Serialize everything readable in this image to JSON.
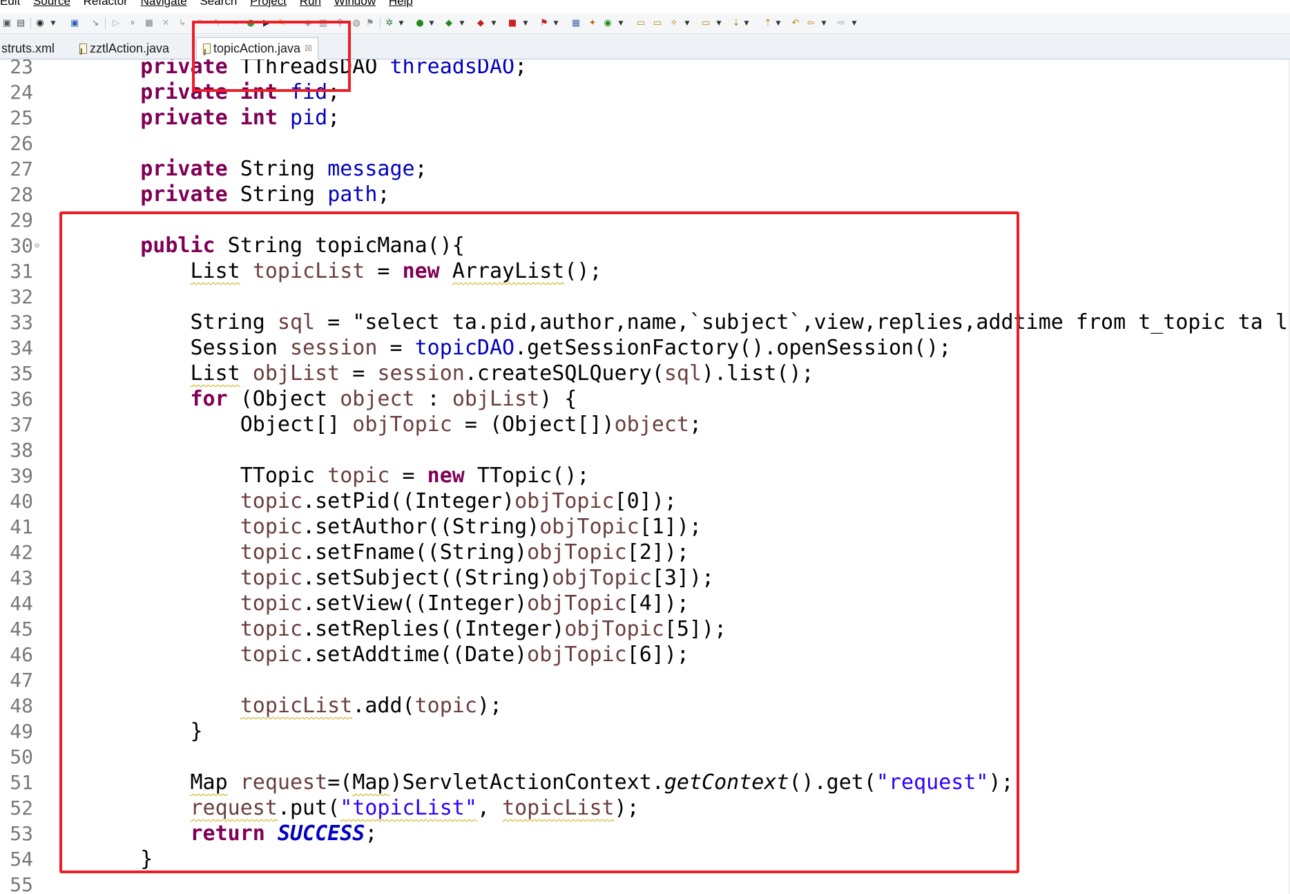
{
  "menu": [
    "Edit",
    "Source",
    "Refactor",
    "Navigate",
    "Search",
    "Project",
    "Run",
    "Window",
    "Help"
  ],
  "tabs": [
    {
      "label": "struts.xml",
      "active": false
    },
    {
      "label": "zztlAction.java",
      "active": false
    },
    {
      "label": "topicAction.java",
      "active": true
    }
  ],
  "close_glyph": "☒",
  "colors": {
    "keyword": "#7f0055",
    "field": "#0000c0",
    "local_variable": "#6a3e3e",
    "string": "#2a00ff",
    "line_number": "#787878",
    "annotation_box": "#ee1c25"
  },
  "editor": {
    "lines": [
      {
        "num": "23",
        "segs": [
          [
            "    ",
            ""
          ],
          [
            "private",
            "kw"
          ],
          [
            " TThreadsDAO ",
            ""
          ],
          [
            "threadsDAO",
            "fld"
          ],
          [
            ";",
            ""
          ]
        ]
      },
      {
        "num": "24",
        "segs": [
          [
            "    ",
            ""
          ],
          [
            "private",
            "kw"
          ],
          [
            " ",
            ""
          ],
          [
            "int",
            "kw"
          ],
          [
            " ",
            ""
          ],
          [
            "fid",
            "fld"
          ],
          [
            ";",
            ""
          ]
        ]
      },
      {
        "num": "25",
        "segs": [
          [
            "    ",
            ""
          ],
          [
            "private",
            "kw"
          ],
          [
            " ",
            ""
          ],
          [
            "int",
            "kw"
          ],
          [
            " ",
            ""
          ],
          [
            "pid",
            "fld"
          ],
          [
            ";",
            ""
          ]
        ]
      },
      {
        "num": "26",
        "segs": []
      },
      {
        "num": "27",
        "segs": [
          [
            "    ",
            ""
          ],
          [
            "private",
            "kw"
          ],
          [
            " String ",
            ""
          ],
          [
            "message",
            "fld"
          ],
          [
            ";",
            ""
          ]
        ]
      },
      {
        "num": "28",
        "segs": [
          [
            "    ",
            ""
          ],
          [
            "private",
            "kw"
          ],
          [
            " String ",
            ""
          ],
          [
            "path",
            "fld"
          ],
          [
            ";",
            ""
          ]
        ]
      },
      {
        "num": "29",
        "segs": []
      },
      {
        "num": "30",
        "mark": "⊖",
        "segs": [
          [
            "    ",
            ""
          ],
          [
            "public",
            "kw"
          ],
          [
            " String topicMana(){",
            ""
          ]
        ]
      },
      {
        "num": "31",
        "segs": [
          [
            "        ",
            ""
          ],
          [
            "List",
            "sq"
          ],
          [
            " ",
            ""
          ],
          [
            "topicList",
            "loc"
          ],
          [
            " = ",
            ""
          ],
          [
            "new",
            "kw"
          ],
          [
            " ",
            ""
          ],
          [
            "ArrayList",
            "sq"
          ],
          [
            "();",
            ""
          ]
        ]
      },
      {
        "num": "32",
        "segs": []
      },
      {
        "num": "33",
        "segs": [
          [
            "        String ",
            ""
          ],
          [
            "sql",
            "loc"
          ],
          [
            " = ",
            ""
          ],
          [
            "\"select ta.pid,author,name,`subject`,view,replies,addtime from t_topic ta left join",
            ""
          ]
        ]
      },
      {
        "num": "34",
        "segs": [
          [
            "        Session ",
            ""
          ],
          [
            "session",
            "loc"
          ],
          [
            " = ",
            ""
          ],
          [
            "topicDAO",
            "fld"
          ],
          [
            ".getSessionFactory().openSession();",
            ""
          ]
        ]
      },
      {
        "num": "35",
        "segs": [
          [
            "        ",
            ""
          ],
          [
            "List",
            "sq"
          ],
          [
            " ",
            ""
          ],
          [
            "objList",
            "loc"
          ],
          [
            " = ",
            ""
          ],
          [
            "session",
            "loc"
          ],
          [
            ".createSQLQuery(",
            ""
          ],
          [
            "sql",
            "loc"
          ],
          [
            ").list();",
            ""
          ]
        ]
      },
      {
        "num": "36",
        "segs": [
          [
            "        ",
            ""
          ],
          [
            "for",
            "kw"
          ],
          [
            " (Object ",
            ""
          ],
          [
            "object",
            "loc"
          ],
          [
            " : ",
            ""
          ],
          [
            "objList",
            "loc"
          ],
          [
            ") {",
            ""
          ]
        ]
      },
      {
        "num": "37",
        "segs": [
          [
            "            Object[] ",
            ""
          ],
          [
            "objTopic",
            "loc"
          ],
          [
            " = (Object[])",
            ""
          ],
          [
            "object",
            "loc"
          ],
          [
            ";",
            ""
          ]
        ]
      },
      {
        "num": "38",
        "segs": []
      },
      {
        "num": "39",
        "segs": [
          [
            "            TTopic ",
            ""
          ],
          [
            "topic",
            "loc"
          ],
          [
            " = ",
            ""
          ],
          [
            "new",
            "kw"
          ],
          [
            " TTopic();",
            ""
          ]
        ]
      },
      {
        "num": "40",
        "segs": [
          [
            "            ",
            ""
          ],
          [
            "topic",
            "loc"
          ],
          [
            ".setPid((Integer)",
            ""
          ],
          [
            "objTopic",
            "loc"
          ],
          [
            "[0]);",
            ""
          ]
        ]
      },
      {
        "num": "41",
        "segs": [
          [
            "            ",
            ""
          ],
          [
            "topic",
            "loc"
          ],
          [
            ".setAuthor((String)",
            ""
          ],
          [
            "objTopic",
            "loc"
          ],
          [
            "[1]);",
            ""
          ]
        ]
      },
      {
        "num": "42",
        "segs": [
          [
            "            ",
            ""
          ],
          [
            "topic",
            "loc"
          ],
          [
            ".setFname((String)",
            ""
          ],
          [
            "objTopic",
            "loc"
          ],
          [
            "[2]);",
            ""
          ]
        ]
      },
      {
        "num": "43",
        "segs": [
          [
            "            ",
            ""
          ],
          [
            "topic",
            "loc"
          ],
          [
            ".setSubject((String)",
            ""
          ],
          [
            "objTopic",
            "loc"
          ],
          [
            "[3]);",
            ""
          ]
        ]
      },
      {
        "num": "44",
        "segs": [
          [
            "            ",
            ""
          ],
          [
            "topic",
            "loc"
          ],
          [
            ".setView((Integer)",
            ""
          ],
          [
            "objTopic",
            "loc"
          ],
          [
            "[4]);",
            ""
          ]
        ]
      },
      {
        "num": "45",
        "segs": [
          [
            "            ",
            ""
          ],
          [
            "topic",
            "loc"
          ],
          [
            ".setReplies((Integer)",
            ""
          ],
          [
            "objTopic",
            "loc"
          ],
          [
            "[5]);",
            ""
          ]
        ]
      },
      {
        "num": "46",
        "segs": [
          [
            "            ",
            ""
          ],
          [
            "topic",
            "loc"
          ],
          [
            ".setAddtime((Date)",
            ""
          ],
          [
            "objTopic",
            "loc"
          ],
          [
            "[6]);",
            ""
          ]
        ]
      },
      {
        "num": "47",
        "segs": []
      },
      {
        "num": "48",
        "segs": [
          [
            "            ",
            ""
          ],
          [
            "topicList",
            "loc sq"
          ],
          [
            ".add(",
            ""
          ],
          [
            "topic",
            "loc"
          ],
          [
            ");",
            ""
          ]
        ]
      },
      {
        "num": "49",
        "segs": [
          [
            "        }",
            ""
          ]
        ]
      },
      {
        "num": "50",
        "segs": []
      },
      {
        "num": "51",
        "segs": [
          [
            "        ",
            ""
          ],
          [
            "Map",
            "sq"
          ],
          [
            " ",
            ""
          ],
          [
            "request",
            "loc"
          ],
          [
            "=(",
            ""
          ],
          [
            "Map",
            "sq"
          ],
          [
            ")ServletActionContext.",
            ""
          ],
          [
            "getContext",
            "it"
          ],
          [
            "().get(",
            ""
          ],
          [
            "\"request\"",
            "str"
          ],
          [
            ");",
            ""
          ]
        ]
      },
      {
        "num": "52",
        "segs": [
          [
            "        ",
            ""
          ],
          [
            "request",
            "loc sq"
          ],
          [
            ".put(",
            ""
          ],
          [
            "\"topicList\"",
            "str sq"
          ],
          [
            ", ",
            ""
          ],
          [
            "topicList",
            "loc sq"
          ],
          [
            ");",
            ""
          ]
        ]
      },
      {
        "num": "53",
        "segs": [
          [
            "        ",
            ""
          ],
          [
            "return",
            "kw"
          ],
          [
            " ",
            ""
          ],
          [
            "SUCCESS",
            "sta"
          ],
          [
            ";",
            ""
          ]
        ]
      },
      {
        "num": "54",
        "segs": [
          [
            "    }",
            ""
          ]
        ]
      },
      {
        "num": "55",
        "segs": []
      }
    ]
  }
}
